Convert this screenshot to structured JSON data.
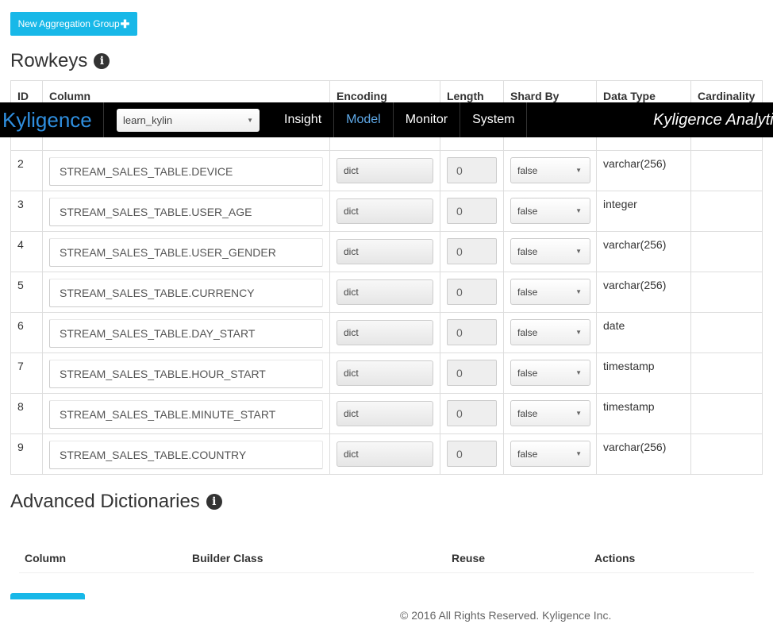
{
  "toolbar": {
    "new_agg_label": "New Aggregation Group",
    "new_agg_icon": "plus-icon"
  },
  "rowkeys": {
    "title": "Rowkeys",
    "headers": {
      "id": "ID",
      "column": "Column",
      "encoding": "Encoding",
      "length": "Length",
      "shard_by": "Shard By",
      "data_type": "Data Type",
      "cardinality": "Cardinality"
    },
    "rows": [
      {
        "id": "2",
        "column": "STREAM_SALES_TABLE.DEVICE",
        "encoding": "dict",
        "length": "0",
        "shard_by": "false",
        "data_type": "varchar(256)"
      },
      {
        "id": "3",
        "column": "STREAM_SALES_TABLE.USER_AGE",
        "encoding": "dict",
        "length": "0",
        "shard_by": "false",
        "data_type": "integer"
      },
      {
        "id": "4",
        "column": "STREAM_SALES_TABLE.USER_GENDER",
        "encoding": "dict",
        "length": "0",
        "shard_by": "false",
        "data_type": "varchar(256)"
      },
      {
        "id": "5",
        "column": "STREAM_SALES_TABLE.CURRENCY",
        "encoding": "dict",
        "length": "0",
        "shard_by": "false",
        "data_type": "varchar(256)"
      },
      {
        "id": "6",
        "column": "STREAM_SALES_TABLE.DAY_START",
        "encoding": "dict",
        "length": "0",
        "shard_by": "false",
        "data_type": "date"
      },
      {
        "id": "7",
        "column": "STREAM_SALES_TABLE.HOUR_START",
        "encoding": "dict",
        "length": "0",
        "shard_by": "false",
        "data_type": "timestamp"
      },
      {
        "id": "8",
        "column": "STREAM_SALES_TABLE.MINUTE_START",
        "encoding": "dict",
        "length": "0",
        "shard_by": "false",
        "data_type": "timestamp"
      },
      {
        "id": "9",
        "column": "STREAM_SALES_TABLE.COUNTRY",
        "encoding": "dict",
        "length": "0",
        "shard_by": "false",
        "data_type": "varchar(256)"
      }
    ]
  },
  "navbar": {
    "brand": "Kyligence",
    "project": "learn_kylin",
    "items": [
      "Insight",
      "Model",
      "Monitor",
      "System"
    ],
    "active": "Model",
    "right_text": "Kyligence Analytics"
  },
  "advanced": {
    "title": "Advanced Dictionaries",
    "headers": {
      "column": "Column",
      "builder_class": "Builder Class",
      "reuse": "Reuse",
      "actions": "Actions"
    }
  },
  "footer": {
    "text": "© 2016 All Rights Reserved. Kyligence Inc."
  },
  "colors": {
    "accent": "#18b8e8",
    "nav_bg": "#000000",
    "brand": "#2f8fe0",
    "nav_active": "#5fa9e8"
  }
}
